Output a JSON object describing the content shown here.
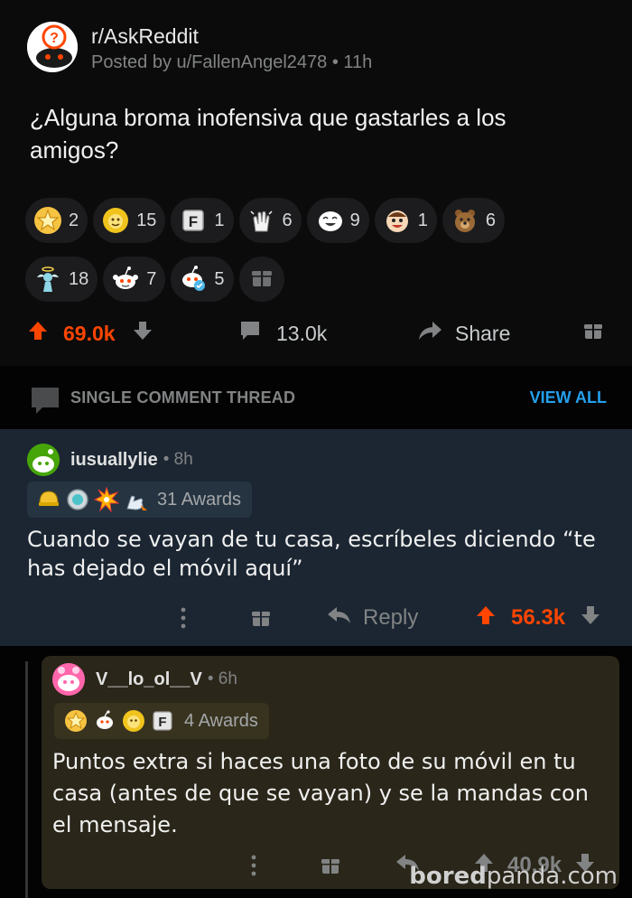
{
  "post": {
    "subreddit": "r/AskReddit",
    "posted_by": "Posted by u/FallenAngel2478 • 11h",
    "title": "¿Alguna broma inofensiva que gastarles a los amigos?",
    "awards_row1": [
      {
        "icon": "gold-star-award-icon",
        "count": "2",
        "color": "#e8b21b"
      },
      {
        "icon": "helpful-lion-award-icon",
        "count": "15",
        "color": "#f0c31d"
      },
      {
        "icon": "press-f-award-icon",
        "count": "1",
        "color": "#e6e6e6"
      },
      {
        "icon": "clapping-hands-award-icon",
        "count": "6",
        "color": "#f4f4f4"
      },
      {
        "icon": "laughing-face-award-icon",
        "count": "9",
        "color": "#ffffff"
      },
      {
        "icon": "wholesome-face-award-icon",
        "count": "1",
        "color": "#f2a26a"
      },
      {
        "icon": "bear-award-icon",
        "count": "6",
        "color": "#9c6a36"
      }
    ],
    "awards_row2": [
      {
        "icon": "angel-award-icon",
        "count": "18",
        "color": "#8fd6e6"
      },
      {
        "icon": "snoo-silver-award-icon",
        "count": "7",
        "color": "#ffffff"
      },
      {
        "icon": "snoo-helpful-award-icon",
        "count": "5",
        "color": "#4fb7e8"
      }
    ],
    "upvotes": "69.0k",
    "comments": "13.0k",
    "share_label": "Share"
  },
  "thread_banner": {
    "label": "SINGLE COMMENT THREAD",
    "link": "VIEW ALL"
  },
  "comment1": {
    "author": "iusuallylie",
    "time": "• 8h",
    "awards_text": "31 Awards",
    "body": "Cuando se vayan de tu casa, escríbeles diciendo “te has dejado el móvil aquí”",
    "reply_label": "Reply",
    "score": "56.3k"
  },
  "comment2": {
    "author": "V__lo_ol__V",
    "time": "• 6h",
    "awards_text": "4 Awards",
    "body": "Puntos extra si haces una foto de su móvil en tu casa (antes de que se vayan) y se la mandas con el mensaje.",
    "score": "40.9k"
  },
  "watermark": {
    "bold": "bored",
    "rest": "panda.com"
  },
  "colors": {
    "accent_upvote": "#ff4500",
    "link_blue": "#24a0ed",
    "comment1_bg": "#1b2632",
    "comment2_bg": "#2a2619"
  }
}
